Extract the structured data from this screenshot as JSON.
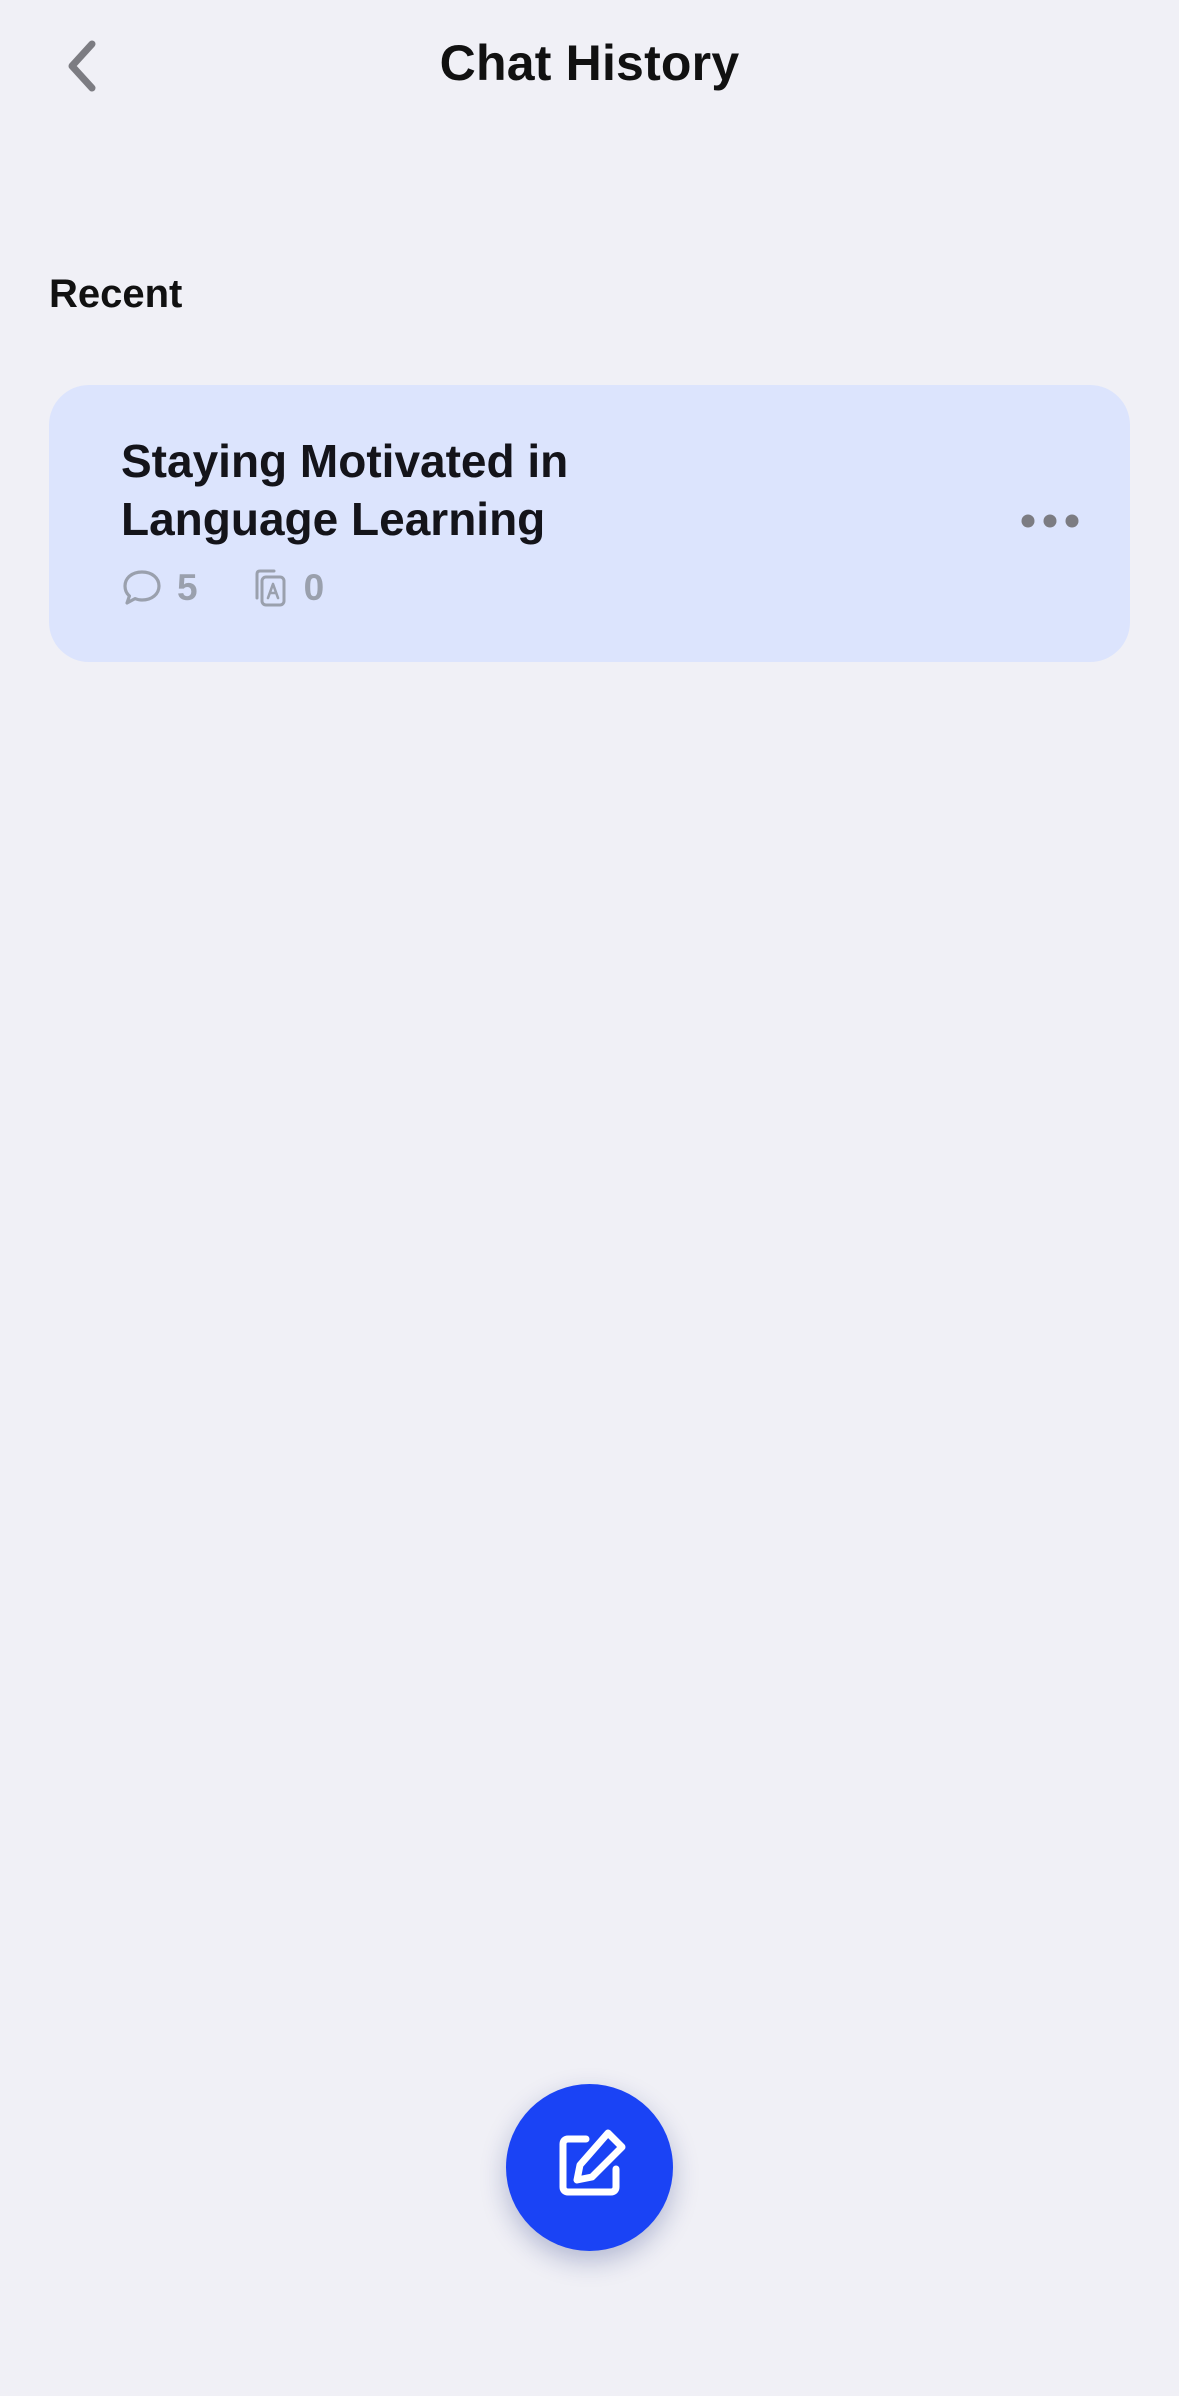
{
  "header": {
    "title": "Chat History",
    "back_icon": "chevron-left-icon"
  },
  "section": {
    "title": "Recent"
  },
  "chats": [
    {
      "title": "Staying Motivated in Language Learning",
      "message_count": "5",
      "message_icon": "speech-bubble-icon",
      "vocab_count": "0",
      "vocab_icon": "flashcards-icon",
      "more_icon": "ellipsis-icon"
    }
  ],
  "fab": {
    "icon": "compose-icon"
  },
  "colors": {
    "background": "#f0f0f6",
    "card": "#dce4fd",
    "accent": "#1a43f5",
    "stat_text": "#9aa0ad",
    "icon_gray": "#7c7c82"
  }
}
